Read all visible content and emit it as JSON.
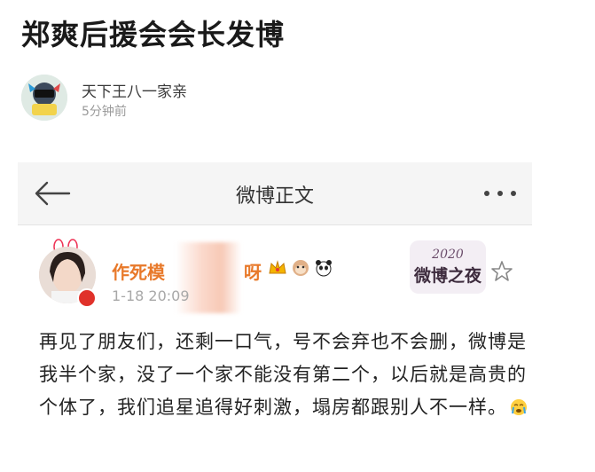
{
  "article": {
    "title": "郑爽后援会会长发博"
  },
  "author": {
    "name": "天下王八一家亲",
    "time": "5分钟前"
  },
  "weibo": {
    "bar_title": "微博正文",
    "poster_name_start": "作死模",
    "poster_name_end": "呀",
    "post_time": "1-18 20:09",
    "badge_text": "2020 微博之夜",
    "post_text": "再见了朋友们，还剩一口气，号不会弃也不会删，微博是我半个家，没了一个家不能没有第二个，以后就是高贵的个体了，我们追星追得好刺激，塌房都跟别人不一样。"
  },
  "colors": {
    "name_orange": "#e8792a",
    "verified_red": "#e0312a",
    "bar_bg": "#f5f5f5"
  }
}
